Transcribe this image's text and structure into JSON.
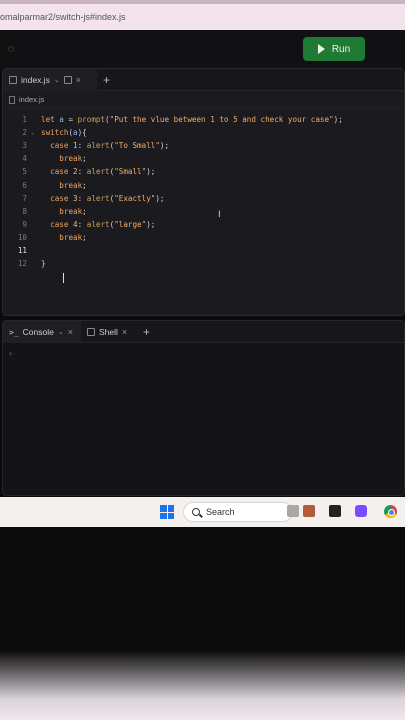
{
  "browser": {
    "url": "omalparmar2/switch-js#index.js"
  },
  "header": {
    "run_label": "Run"
  },
  "editor": {
    "tab_label": "index.js",
    "breadcrumb": "index.js",
    "lines": [
      {
        "n": "1",
        "text": "let a = prompt(\"Put the vlue between 1 to 5 and check your case\");"
      },
      {
        "n": "2",
        "text": "switch(a){"
      },
      {
        "n": "3",
        "text": "  case 1: alert(\"To Small\");"
      },
      {
        "n": "4",
        "text": "    break;"
      },
      {
        "n": "5",
        "text": "  case 2: alert(\"Small\");"
      },
      {
        "n": "6",
        "text": "    break;"
      },
      {
        "n": "7",
        "text": "  case 3: alert(\"Exactly\");"
      },
      {
        "n": "8",
        "text": "    break;"
      },
      {
        "n": "9",
        "text": "  case 4: alert(\"large\");"
      },
      {
        "n": "10",
        "text": "    break;"
      },
      {
        "n": "11",
        "text": "    "
      },
      {
        "n": "12",
        "text": "}"
      }
    ],
    "active_line": "11"
  },
  "console": {
    "tab_console": "Console",
    "tab_shell": "Shell",
    "prompt": "›"
  },
  "taskbar": {
    "search_placeholder": "Search"
  },
  "colors": {
    "run": "#1f7a33",
    "accent_windows": "#1a73e8"
  }
}
